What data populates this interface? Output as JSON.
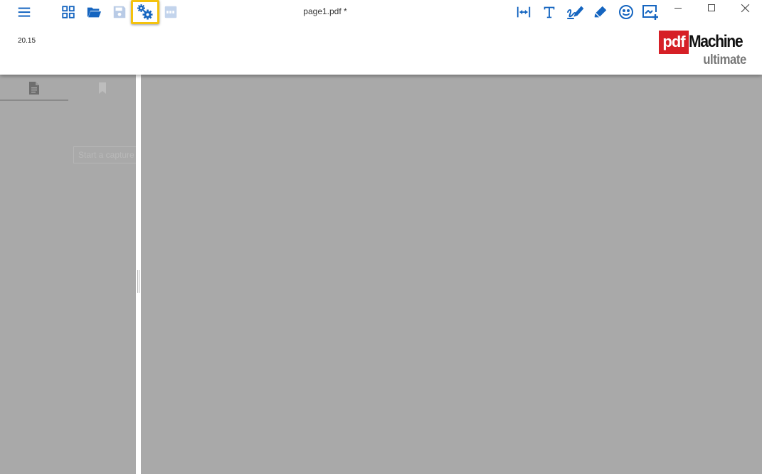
{
  "window": {
    "title": "page1.pdf *"
  },
  "app": {
    "version": "20.15"
  },
  "logo": {
    "pdf": "pdf",
    "machine": "Machine",
    "edition": "ultimate"
  },
  "toolbar_left": {
    "menu_icon": "hamburger-menu-icon",
    "items": [
      "apps-grid-icon",
      "open-folder-icon",
      "save-icon",
      "settings-icon",
      "pdf-export-icon"
    ],
    "highlighted": "settings-icon"
  },
  "toolbar_right": {
    "items": [
      "fit-width-icon",
      "text-icon",
      "signature-icon",
      "highlighter-icon",
      "emoji-icon",
      "add-image-icon"
    ]
  },
  "window_controls": [
    "minimize-icon",
    "maximize-icon",
    "close-icon"
  ],
  "sidebar": {
    "tabs": [
      "pages-tab",
      "bookmarks-tab"
    ],
    "active_tab": "pages-tab",
    "capture_placeholder": "Start a capture"
  },
  "colors": {
    "accent": "#1565c0",
    "disabled": "#b9cbe6",
    "highlight": "#f4c20d",
    "background": "#a9a9a9",
    "logo_red": "#d61f26"
  }
}
